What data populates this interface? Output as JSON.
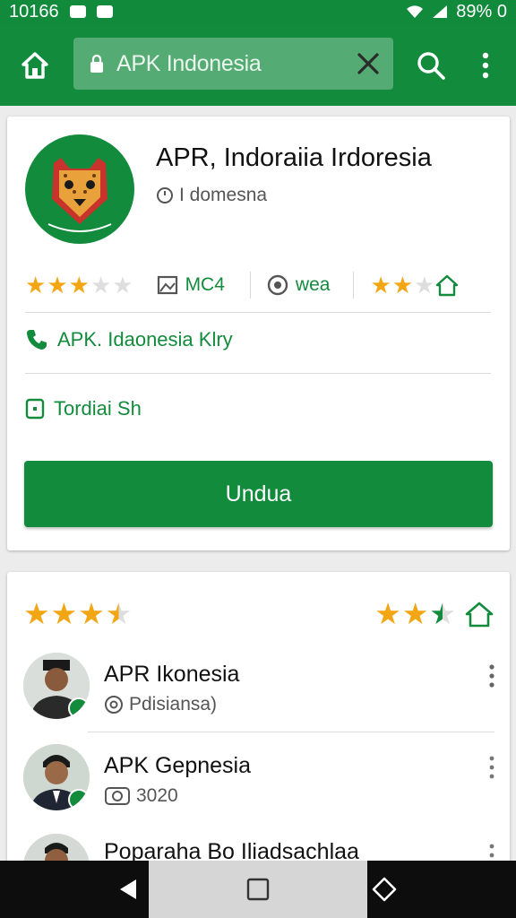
{
  "status_bar": {
    "time": "10166",
    "battery": "89% 0"
  },
  "toolbar": {
    "url": "APK Indonesia",
    "icons": [
      "home-icon",
      "lock-icon",
      "clear-icon",
      "search-icon",
      "more-vert-icon"
    ]
  },
  "app_card": {
    "title": "APR, Indoraiia Irdoresia",
    "subtitle": "I domesna",
    "rating_left": 3.5,
    "stat1": "MC4",
    "stat2": "wea",
    "rating_right": 2,
    "phone_text": "APK. Idaonesia Klry",
    "terms_text": "Tordiai Sh",
    "download_label": "Undua"
  },
  "reviews_card": {
    "rating_left": 3.5,
    "rating_right": 2.5,
    "items": [
      {
        "name": "APR Ikonesia",
        "sub": "Pdisiansa)"
      },
      {
        "name": "APK Gepnesia",
        "sub": "3020"
      },
      {
        "name": "Poparaha Bo Iliadsachlaa",
        "sub": ""
      }
    ]
  },
  "colors": {
    "brand_green": "#138b3d",
    "star_orange": "#f2a614"
  }
}
